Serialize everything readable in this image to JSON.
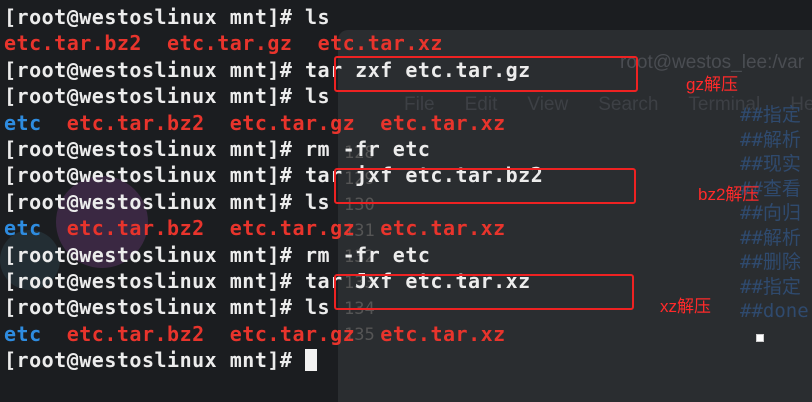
{
  "background": {
    "window_title": "root@westos_lee:/var",
    "menu": [
      "File",
      "Edit",
      "View",
      "Search",
      "Terminal",
      "Help"
    ],
    "comments": [
      "##指定",
      "##解析",
      "##现实",
      "##查看",
      "##向归",
      "##解析",
      "##删除",
      "##指定",
      "##done"
    ],
    "line_numbers": [
      "128",
      "129",
      "130",
      "131",
      "132",
      "133",
      "134",
      "135"
    ]
  },
  "prompt": "[root@westoslinux mnt]# ",
  "lines": [
    {
      "type": "cmd",
      "text": "ls"
    },
    {
      "type": "out",
      "items": [
        {
          "t": "etc.tar.bz2",
          "c": "arc"
        },
        {
          "t": "etc.tar.gz",
          "c": "arc"
        },
        {
          "t": "etc.tar.xz",
          "c": "arc"
        }
      ]
    },
    {
      "type": "cmd",
      "text": "tar zxf etc.tar.gz"
    },
    {
      "type": "cmd",
      "text": "ls"
    },
    {
      "type": "out",
      "items": [
        {
          "t": "etc",
          "c": "dir"
        },
        {
          "t": "etc.tar.bz2",
          "c": "arc"
        },
        {
          "t": "etc.tar.gz",
          "c": "arc"
        },
        {
          "t": "etc.tar.xz",
          "c": "arc"
        }
      ]
    },
    {
      "type": "cmd",
      "text": "rm -fr etc"
    },
    {
      "type": "cmd",
      "text": "tar jxf etc.tar.bz2"
    },
    {
      "type": "cmd",
      "text": "ls"
    },
    {
      "type": "out",
      "items": [
        {
          "t": "etc",
          "c": "dir"
        },
        {
          "t": "etc.tar.bz2",
          "c": "arc"
        },
        {
          "t": "etc.tar.gz",
          "c": "arc"
        },
        {
          "t": "etc.tar.xz",
          "c": "arc"
        }
      ]
    },
    {
      "type": "cmd",
      "text": "rm -fr etc"
    },
    {
      "type": "cmd",
      "text": "tar Jxf etc.tar.xz"
    },
    {
      "type": "cmd",
      "text": "ls"
    },
    {
      "type": "out",
      "items": [
        {
          "t": "etc",
          "c": "dir"
        },
        {
          "t": "etc.tar.bz2",
          "c": "arc"
        },
        {
          "t": "etc.tar.gz",
          "c": "arc"
        },
        {
          "t": "etc.tar.xz",
          "c": "arc"
        }
      ]
    },
    {
      "type": "cursor",
      "text": ""
    }
  ],
  "annotations": {
    "gz": "gz解压",
    "bz2": "bz2解压",
    "xz": "xz解压"
  },
  "colors": {
    "directory": "#2e8ce0",
    "archive": "#e8342c",
    "highlight_box": "#ee2222",
    "annotation_text": "#ff2a2a"
  }
}
